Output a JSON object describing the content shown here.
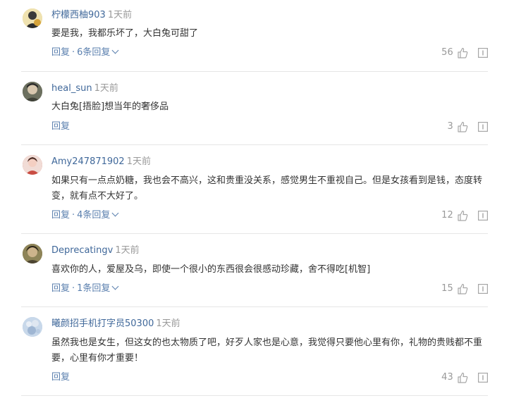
{
  "comments": [
    {
      "user": "柠檬西柚903",
      "time": "1天前",
      "text": "要是我，我都乐坏了，大白兔可甜了",
      "reply_label": "回复",
      "sub_replies": "6条回复",
      "likes": "56",
      "avatar_color": "#e0c97a"
    },
    {
      "user": "heal_sun",
      "time": "1天前",
      "text": "大白兔[捂脸]想当年的奢侈品",
      "reply_label": "回复",
      "sub_replies": "",
      "likes": "3",
      "avatar_color": "#5b5f55"
    },
    {
      "user": "Amy247871902",
      "time": "1天前",
      "text": "如果只有一点点奶糖，我也会不高兴，这和贵重没关系，感觉男生不重视自己。但是女孩看到是钱，态度转变，就有点不大好了。",
      "reply_label": "回复",
      "sub_replies": "4条回复",
      "likes": "12",
      "avatar_color": "#c85a4c"
    },
    {
      "user": "Deprecatingv",
      "time": "1天前",
      "text": "喜欢你的人，爱屋及乌，即使一个很小的东西很会很感动珍藏，舍不得吃[机智]",
      "reply_label": "回复",
      "sub_replies": "1条回复",
      "likes": "15",
      "avatar_color": "#7c6f4e"
    },
    {
      "user": "曦颜招手机打字员50300",
      "time": "1天前",
      "text": "虽然我也是女生，但这女的也太物质了吧，好歹人家也是心意，我觉得只要他心里有你，礼物的贵贱都不重要，心里有你才重要！",
      "reply_label": "回复",
      "sub_replies": "",
      "likes": "43",
      "avatar_color": "#a9c1dd"
    }
  ],
  "colors": {
    "username": "#40689a",
    "action": "#5a7fae",
    "muted": "#999999",
    "text": "#333333",
    "separator": "#e6e6e6"
  },
  "icons": [
    "thumbs-up-icon",
    "report-icon",
    "chevron-down-icon"
  ]
}
